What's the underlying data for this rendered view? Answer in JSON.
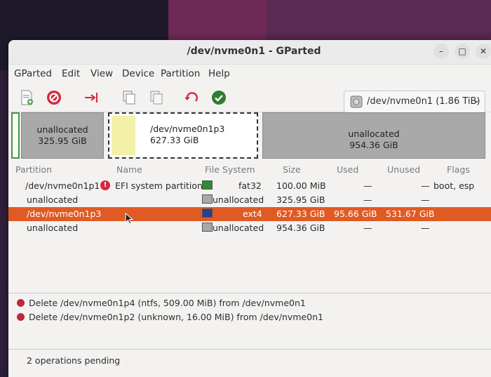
{
  "window": {
    "title": "/dev/nvme0n1 - GParted"
  },
  "menu": [
    "GParted",
    "Edit",
    "View",
    "Device",
    "Partition",
    "Help"
  ],
  "toolbar": {
    "device_label": "/dev/nvme0n1 (1.86 TiB)"
  },
  "graph": [
    {
      "label": "unallocated",
      "size": "325.95 GiB"
    },
    {
      "label": "/dev/nvme0n1p3",
      "size": "627.33 GiB"
    },
    {
      "label": "unallocated",
      "size": "954.36 GiB"
    }
  ],
  "columns": [
    "Partition",
    "Name",
    "File System",
    "Size",
    "Used",
    "Unused",
    "Flags"
  ],
  "rows": [
    {
      "partition": "/dev/nvme0n1p1",
      "name": "EFI system partition",
      "fs": "fat32",
      "size": "100.00 MiB",
      "used": "—",
      "unused": "—",
      "flags": "boot, esp",
      "color": "#2e8b2e"
    },
    {
      "partition": "unallocated",
      "name": "",
      "fs": "unallocated",
      "size": "325.95 GiB",
      "used": "—",
      "unused": "—",
      "flags": "",
      "color": "#a8a8a8"
    },
    {
      "partition": "/dev/nvme0n1p3",
      "name": "",
      "fs": "ext4",
      "size": "627.33 GiB",
      "used": "95.66 GiB",
      "unused": "531.67 GiB",
      "flags": "",
      "color": "#2b3f8c"
    },
    {
      "partition": "unallocated",
      "name": "",
      "fs": "unallocated",
      "size": "954.36 GiB",
      "used": "—",
      "unused": "—",
      "flags": "",
      "color": "#a8a8a8"
    }
  ],
  "operations": [
    "Delete /dev/nvme0n1p4 (ntfs, 509.00 MiB) from /dev/nvme0n1",
    "Delete /dev/nvme0n1p2 (unknown, 16.00 MiB) from /dev/nvme0n1"
  ],
  "status": "2 operations pending",
  "colors": {
    "selection": "#e05a24",
    "ext4": "#2b3f8c",
    "fat32": "#2e8b2e",
    "unallocated": "#a8a8a8"
  }
}
